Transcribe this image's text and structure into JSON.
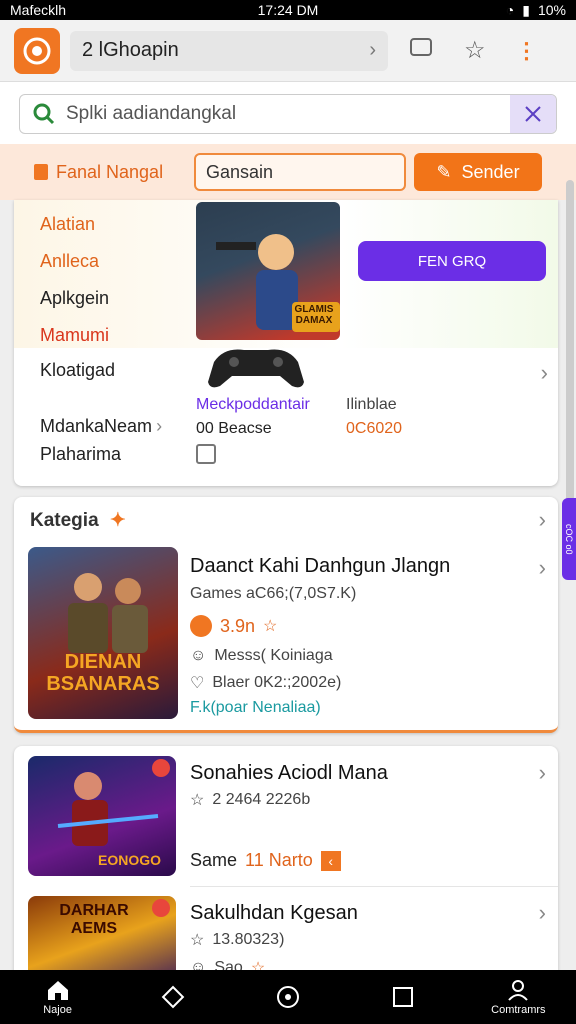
{
  "status": {
    "carrier": "Mafecklh",
    "time": "17:24 DM",
    "battery": "10%"
  },
  "appbar": {
    "url_text": "2 lGhoapin"
  },
  "search": {
    "placeholder": "Splki aadiandangkal"
  },
  "filter": {
    "label": "Fanal Nangal",
    "input_value": "Gansain",
    "button_label": "Sender"
  },
  "card1": {
    "menu": [
      "Alatian",
      "Anlleca",
      "Aplkgein",
      "Mamumi"
    ],
    "button_label": "FEN GRQ",
    "banner_text": "GLAMIS DAMAX",
    "rows": [
      "Kloatigad",
      "MdankaNeam",
      "Plaharima"
    ],
    "meta_title": "Meckpoddantair",
    "meta_line": "00 Beacse",
    "meta2_title": "Ilinblae",
    "meta2_value": "0C6020"
  },
  "section": {
    "title": "Kategia"
  },
  "games": [
    {
      "title": "Daanct Kahi Danhgun Jlangn",
      "sub": "Games aC66;(7,0S7.K)",
      "rating": "3.9n",
      "line1": "Messs( Koiniaga",
      "line2": "Blaer 0K2:;2002e)",
      "link": "F.k(poar Nenaliaa)",
      "art": "DIENAN BSANARAS"
    },
    {
      "title": "Sonahies Aciodl Mana",
      "sub": "2 2464 2226b",
      "line1": "Same",
      "line1b": "11 Narto",
      "art": "EONOGO"
    },
    {
      "title": "Sakulhdan Kgesan",
      "sub": "13.80323)",
      "line1": "Sao",
      "art": "DARHAR AEMS"
    }
  ],
  "sidetab": "cOC o0",
  "nav": [
    {
      "label": "Najoe",
      "icon": "home-icon"
    },
    {
      "label": "",
      "icon": "diamond-icon"
    },
    {
      "label": "",
      "icon": "circle-icon"
    },
    {
      "label": "",
      "icon": "square-icon"
    },
    {
      "label": "Comtramrs",
      "icon": "profile-icon"
    }
  ]
}
